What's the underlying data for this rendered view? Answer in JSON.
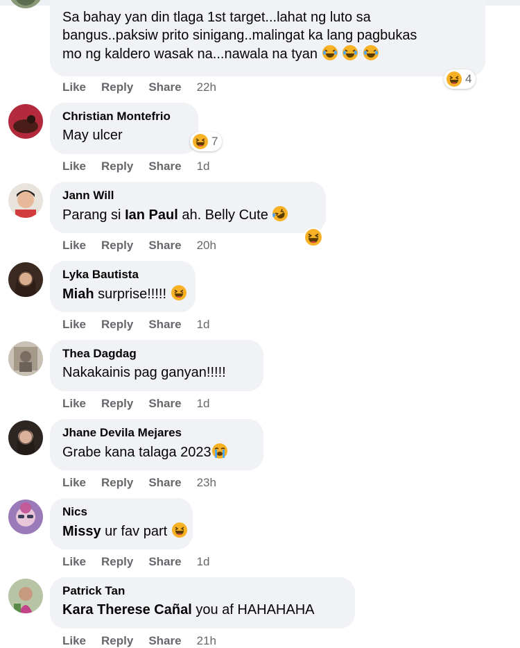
{
  "actions": {
    "like": "Like",
    "reply": "Reply",
    "share": "Share"
  },
  "comments": [
    {
      "author": "",
      "text": "Sa bahay yan din tlaga 1st target...lahat ng luto sa bangus..paksiw prito sinigang..malingat ka lang pagbukas mo ng kaldero wasak na...nawala na tyan",
      "line1": "Sa bahay yan din tlaga 1st target...lahat ng luto sa",
      "line2": "bangus..paksiw prito sinigang..malingat ka lang pagbukas",
      "line3": "mo ng kaldero wasak na...nawala na tyan",
      "time": "22h",
      "reaction_count": "4"
    },
    {
      "author": "Christian Montefrio",
      "text": "May ulcer",
      "time": "1d",
      "reaction_count": "7"
    },
    {
      "author": "Jann Will",
      "text_a": "Parang si ",
      "mention": "Ian Paul",
      "text_b": " ah. Belly Cute",
      "time": "20h"
    },
    {
      "author": "Lyka Bautista",
      "mention": "Miah",
      "text_b": " surprise!!!!!",
      "time": "1d"
    },
    {
      "author": "Thea Dagdag",
      "text": "Nakakainis pag ganyan!!!!!",
      "time": "1d"
    },
    {
      "author": "Jhane Devila Mejares",
      "text": "Grabe kana talaga 2023",
      "time": "23h"
    },
    {
      "author": "Nics",
      "mention": "Missy",
      "text_b": " ur fav part",
      "time": "1d"
    },
    {
      "author": "Patrick Tan",
      "mention": "Kara Therese Cañal",
      "text_b": " you af HAHAHAHA",
      "time": "21h"
    }
  ],
  "colors": {
    "bubble": "#f0f2f5",
    "action_text": "#65676b",
    "name_text": "#050505",
    "emoji_face": "#f7b125"
  }
}
